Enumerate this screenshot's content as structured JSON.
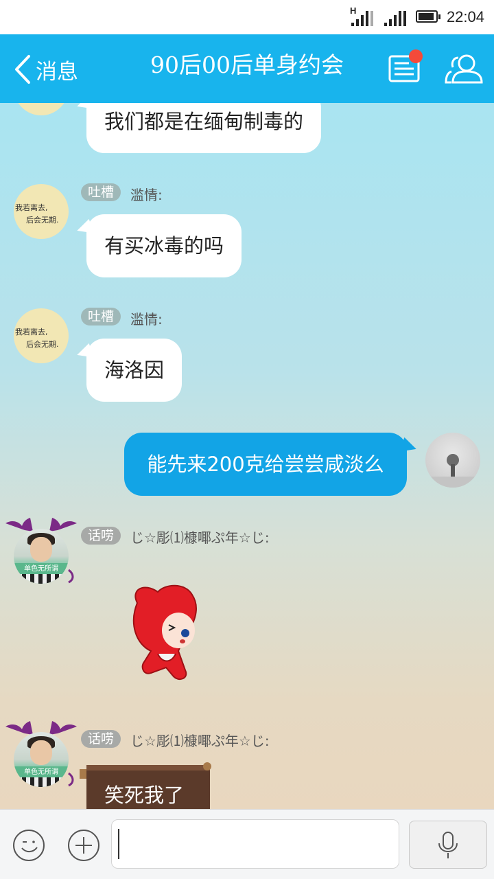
{
  "status_bar": {
    "network_type": "H",
    "time": "22:04"
  },
  "header": {
    "back_label": "消息",
    "title": "90后00后单身约会",
    "accent_color": "#18b4ed",
    "notice_dot_color": "#f44a3a"
  },
  "messages": [
    {
      "text": "我们都是在缅甸制毒的"
    },
    {
      "tag": "吐槽",
      "nick": "滥情:",
      "text": "有买冰毒的吗",
      "avatar_text_1": "我若离去,",
      "avatar_text_2": "后会无期."
    },
    {
      "tag": "吐槽",
      "nick": "滥情:",
      "text": "海洛因",
      "avatar_text_1": "我若离去,",
      "avatar_text_2": "后会无期."
    },
    {
      "text": "能先来200克给尝尝咸淡么",
      "self": true
    },
    {
      "tag": "话唠",
      "nick": "じ☆彫⑴槺㖿ぷ年☆じ:",
      "sticker": "red-fox-sticker",
      "avatar_text": "单色无所谓"
    },
    {
      "tag": "话唠",
      "nick": "じ☆彫⑴槺㖿ぷ年☆じ:",
      "text": "笑死我了",
      "avatar_text": "单色无所谓"
    }
  ],
  "input_bar": {
    "placeholder": ""
  }
}
